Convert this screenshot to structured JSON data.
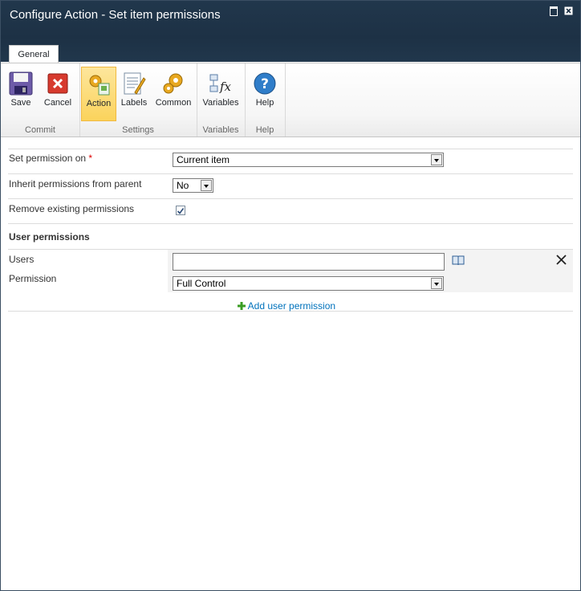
{
  "window": {
    "title": "Configure Action - Set item permissions"
  },
  "ribbon": {
    "tab": "General",
    "groups": {
      "commit": "Commit",
      "settings": "Settings",
      "variables": "Variables",
      "help": "Help"
    },
    "buttons": {
      "save": "Save",
      "cancel": "Cancel",
      "action": "Action",
      "labels": "Labels",
      "common": "Common",
      "variables": "Variables",
      "help": "Help"
    }
  },
  "form": {
    "set_permission_on": {
      "label": "Set permission on",
      "required_mark": "*",
      "value": "Current item"
    },
    "inherit": {
      "label": "Inherit permissions from parent",
      "value": "No"
    },
    "remove_existing": {
      "label": "Remove existing permissions",
      "checked": true
    },
    "user_permissions": {
      "heading": "User permissions",
      "users_label": "Users",
      "users_value": "",
      "permission_label": "Permission",
      "permission_value": "Full Control",
      "add_link": "Add user permission"
    }
  },
  "colors": {
    "titlebar": "#1d3145",
    "active_button": "#fbd35c",
    "link": "#0072bc",
    "add_icon": "#3a9d23"
  }
}
